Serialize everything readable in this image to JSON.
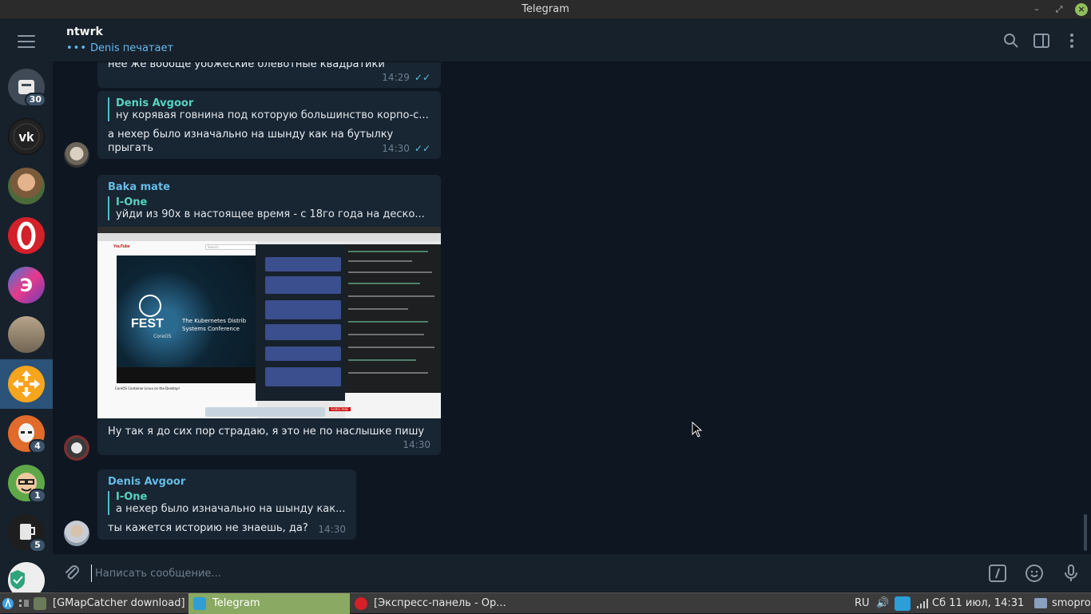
{
  "window": {
    "title": "Telegram"
  },
  "sidebar": {
    "items": [
      {
        "name": "saved",
        "badge": "30"
      },
      {
        "name": "vk",
        "badge": ""
      },
      {
        "name": "user-photo",
        "badge": ""
      },
      {
        "name": "opera",
        "badge": ""
      },
      {
        "name": "app",
        "badge": ""
      },
      {
        "name": "room",
        "badge": ""
      },
      {
        "name": "selected",
        "badge": ""
      },
      {
        "name": "stormtrooper",
        "badge": "4"
      },
      {
        "name": "cartoon",
        "badge": "1"
      },
      {
        "name": "mug",
        "badge": "5"
      },
      {
        "name": "shield",
        "badge": ""
      }
    ]
  },
  "header": {
    "chat_name": "ntwrk",
    "status": "Denis печатает",
    "status_dots": "•••"
  },
  "messages": [
    {
      "text": "нее же вообще убожеские блевотные квадратики",
      "time": "14:29",
      "checks": "✓✓"
    },
    {
      "reply_name": "Denis Avgoor",
      "reply_text": "ну корявая говнина под которую большинство корпо-с...",
      "text": "а нехер было изначально на шынду как на бутылку прыгать",
      "time": "14:30",
      "checks": "✓✓"
    },
    {
      "sender": "Baka mate",
      "reply_name": "I-One",
      "reply_text": "уйди из 90х в настоящее время - с 18го года на деско...",
      "text": "Ну так я до сих пор страдаю, я это не по наслышке пишу",
      "time": "14:30"
    },
    {
      "sender": "Denis Avgoor",
      "reply_name": "I-One",
      "reply_text": "а нехер было изначально на шынду как...",
      "text": "ты кажется историю не знаешь, да?",
      "time": "14:30"
    }
  ],
  "screenshot": {
    "site": "YouTube",
    "search": "Search",
    "banner_title": "FEST",
    "banner_sub": "CoreOS",
    "banner_line1": "The Kubernetes Distrib",
    "banner_line2": "Systems Conference",
    "video_title": "CoreOS Container Linux on the Desktop!",
    "subscribe": "SUBSCRIBE"
  },
  "composer": {
    "placeholder": "Написать сообщение..."
  },
  "taskbar": {
    "tasks": [
      {
        "label": "[GMapCatcher download]"
      },
      {
        "label": "Telegram"
      },
      {
        "label": "[Экспресс-панель - Op..."
      }
    ],
    "lang": "RU",
    "datetime": "Сб 11 июл, 14:31",
    "user": "smopro"
  },
  "colors": {
    "accent": "#2b5278",
    "taskbar_active": "#8aa962",
    "link": "#65bce6",
    "reply": "#59d3c0"
  }
}
